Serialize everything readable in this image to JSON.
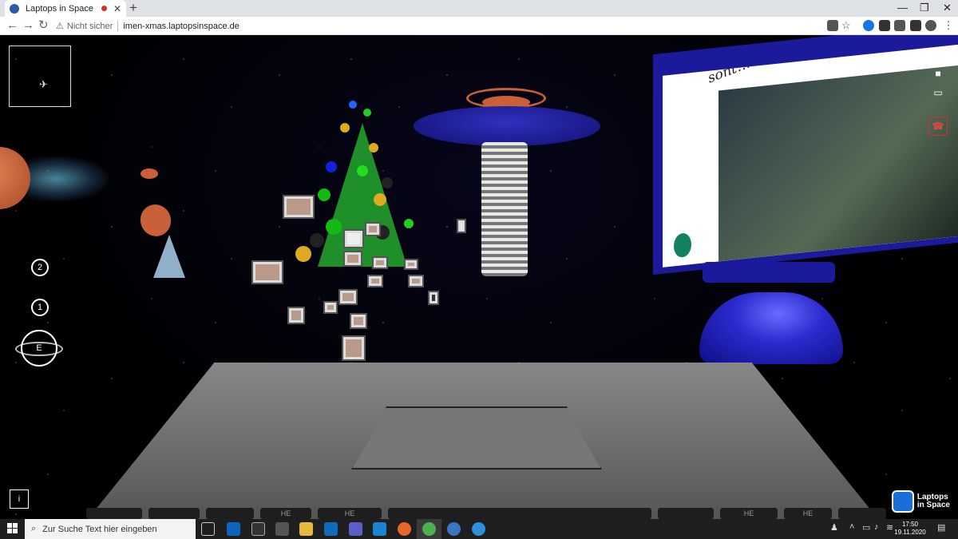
{
  "browser": {
    "tab_title": "Laptops in Space",
    "newtab_label": "+",
    "tab_close_label": "✕",
    "window_controls": [
      "—",
      "❐",
      "✕"
    ],
    "address": {
      "security_label": "Nicht sicher",
      "url": "imen-xmas.laptopsinspace.de"
    }
  },
  "scene": {
    "floor_buttons": [
      "2",
      "1"
    ],
    "earth_button_label": "E",
    "info_button_label": "i",
    "screen_text": "sont… was …",
    "brand_line1": "Laptops",
    "brand_line2": "in Space",
    "keyboard_keys": [
      "",
      "",
      "",
      "HE",
      "HE",
      "",
      "",
      "HE",
      "HE",
      ""
    ]
  },
  "call_controls": {
    "mic": "mic-off-icon",
    "camera": "camera-icon",
    "screen": "screen-share-icon",
    "hangup": "hangup-icon"
  },
  "taskbar": {
    "search_placeholder": "Zur Suche Text hier eingeben",
    "time": "17:50",
    "date": "19.11.2020"
  },
  "colors": {
    "grid": "#4a3cff",
    "hangup": "#e44",
    "dome": "#2b2bcf",
    "tree": "#1f8f2a"
  }
}
